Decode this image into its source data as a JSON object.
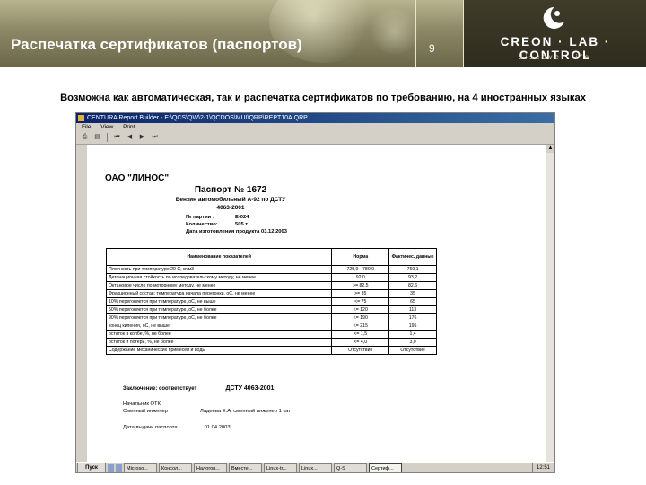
{
  "header": {
    "title": "Распечатка сертификатов (паспортов)",
    "slide_number": "9",
    "logo_text": "CREON · LAB · CONTROL",
    "logo_sub": "discover life"
  },
  "caption": "Возможна как автоматическая, так и распечатка сертификатов по требованию, на 4 иностранных языках",
  "window": {
    "title": "CENTURA Report Builder - E:\\QCS\\QW\\2-1\\QCDOS\\MUI\\QRP\\REPT10A.QRP",
    "menu": [
      "File",
      "View",
      "Print"
    ],
    "toolbar": [
      "print-icon",
      "print-preview-icon",
      "first-page-icon",
      "prev-page-icon",
      "next-page-icon",
      "last-page-icon"
    ]
  },
  "document": {
    "org": "ОАО \"ЛИНОС\"",
    "title": "Паспорт № 1672",
    "subtitle": "Бензин автомобильный А-92 по ДСТУ",
    "standard": "4063-2001",
    "meta": [
      {
        "label": "№ партии :",
        "value": "Е-024"
      },
      {
        "label": "Количество:",
        "value": "505         т"
      },
      {
        "label": "Дата изготовления продукта",
        "value": "03.12.2003"
      }
    ],
    "table": {
      "headers": [
        "Наименование показателей",
        "Норма",
        "Фактичес. данные"
      ],
      "rows": [
        [
          "Плотность при температуре 20 С, кг/м3",
          "725,0 - 780,0",
          "760,1"
        ],
        [
          "Детонационная стойкость по исследовательскому методу, не менее",
          "92,0",
          "93,2"
        ],
        [
          "Октановое число по моторному методу, не менее",
          ">= 82,5",
          "82,6"
        ],
        [
          "Фракционный состав: температура начала перегонки, оС, не менее",
          ">= 35",
          "35"
        ],
        [
          "10% перегоняется при температуре, оС, не выше",
          "<= 75",
          "65"
        ],
        [
          "50% перегоняется при температуре, оС, не более",
          "<= 120",
          "113"
        ],
        [
          "90% перегоняется при температуре, оС, не более",
          "<= 190",
          "176"
        ],
        [
          "конец кипения, оС, не выше",
          "<= 215",
          "195"
        ],
        [
          "остаток в колбе, %, не более",
          "<= 1,5",
          "1,4"
        ],
        [
          "остаток и потери, %, не более",
          "<= 4,0",
          "3,0"
        ],
        [
          "Содержание механических примесей и воды",
          "Отсутствие",
          "Отсутствие"
        ]
      ]
    },
    "conclusion_label": "Заключение: соответствует",
    "conclusion_value": "ДСТУ 4063-2001",
    "sign_role1": "Начальник ОТК",
    "sign_role2": "Сменный инженер",
    "sign_name2": "Ладеева Е.А. сменный инженер 1 кат",
    "issue_label": "Дата выдачи паспорта",
    "issue_date": "01.04.2003"
  },
  "taskbar": {
    "start": "Пуск",
    "tasks": [
      "Microso...",
      "Консол...",
      "Налогов...",
      "Вместе...",
      "Linux-tr...",
      "Linux...",
      "Q-S",
      "Сертиф..."
    ],
    "clock": "12:51"
  }
}
